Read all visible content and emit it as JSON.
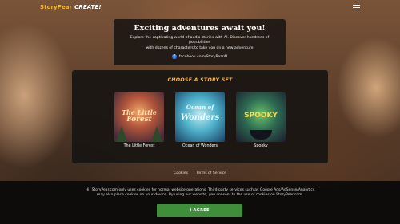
{
  "header": {
    "brand": "StoryPear",
    "create_label": "CREATE!",
    "menu_icon": "hamburger-menu-icon"
  },
  "hero": {
    "title": "Exciting adventures await you!",
    "description_line1": "Explore the captivating world of audio stories with AI. Discover hundreds of possibilities",
    "description_line2": "with dozens of characters to take you on a new adventure",
    "facebook_link": "facebook.com/StoryPearAI",
    "facebook_icon": "facebook-icon"
  },
  "story_sets": {
    "heading": "CHOOSE A STORY SET",
    "items": [
      {
        "title": "The Little Forest",
        "cover_line1": "The Little",
        "cover_line2": "Forest"
      },
      {
        "title": "Ocean of Wonders",
        "cover_line1": "Ocean of",
        "cover_line2": "Wonders"
      },
      {
        "title": "Spooky",
        "cover_line1": "SPOOKY"
      }
    ]
  },
  "footer": {
    "links": [
      "Cookies",
      "Terms of Service"
    ]
  },
  "cookie_banner": {
    "text_line1": "Hi! StoryPear.com only uses cookies for normal website operations. Third-party services such as Google Ads/AdSense/Analytics",
    "text_line2": "may also place cookies on your device. By using our website, you consent to the use of cookies on StoryPear.com.",
    "agree_label": "I AGREE"
  },
  "colors": {
    "accent": "#f7b23b",
    "agree_button": "#3e8e3a",
    "facebook": "#3b7ff2"
  }
}
